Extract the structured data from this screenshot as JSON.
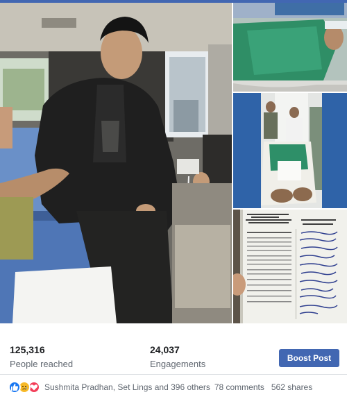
{
  "photos": {
    "main_alt": "Man seated in ambulance holding a drip line",
    "thumb1_alt": "Patient lying on green stretcher",
    "thumb2_alt": "Patient on stretcher in hospital corridor with attendants",
    "thumb3_alt": "Referral card document"
  },
  "referral_card": {
    "header_lines": [
      "WEST BENGAL HEALTH SECTOR DEVELOPMENT",
      "PROGRAMME",
      "DEPARTMENT OF HEALTH AND FAMILY WELFARE",
      "GOVERNMENT OF WEST BENGAL"
    ],
    "title": "REFERRAL CARD",
    "instructions": "INSTRUCTIONS"
  },
  "insights": {
    "reached_value": "125,316",
    "reached_label": "People reached",
    "engagements_value": "24,037",
    "engagements_label": "Engagements",
    "boost_label": "Boost Post"
  },
  "reactions": {
    "icons": [
      "like-icon",
      "sad-icon",
      "love-icon"
    ],
    "names": "Sushmita Pradhan, Set Lings and 396 others",
    "comments": "78 comments",
    "shares": "562 shares"
  },
  "colors": {
    "brand": "#4267b2",
    "like": "#1877f2",
    "sad": "#f7b928",
    "love": "#f33e58"
  }
}
